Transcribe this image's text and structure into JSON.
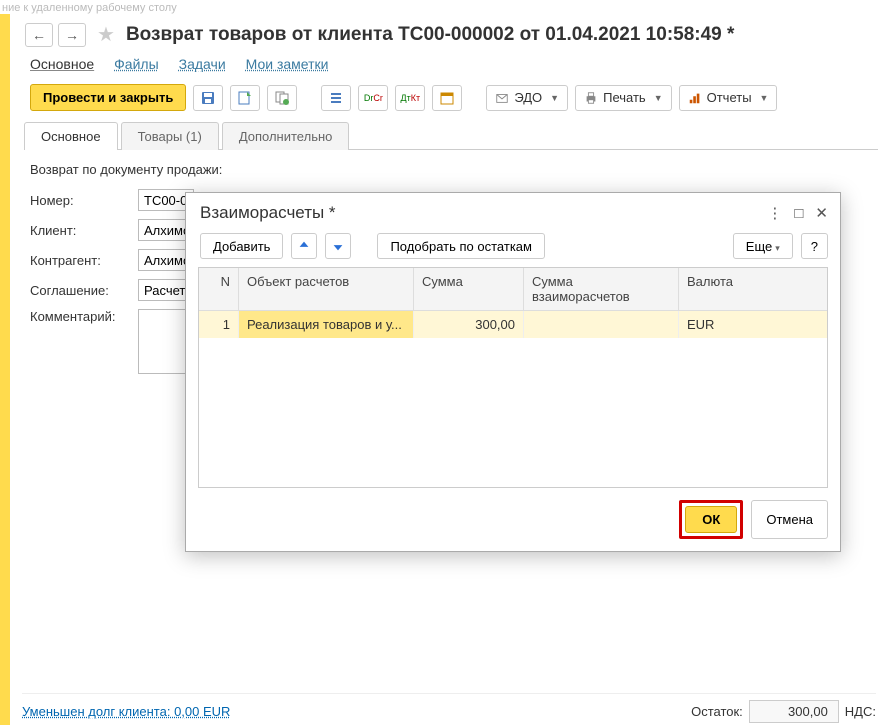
{
  "faded_top": "ние к удаленному рабочему столу",
  "header": {
    "title": "Возврат товаров от клиента ТС00-000002 от 01.04.2021 10:58:49 *"
  },
  "links": {
    "main": "Основное",
    "files": "Файлы",
    "tasks": "Задачи",
    "notes": "Мои заметки"
  },
  "toolbar": {
    "post_close": "Провести и закрыть",
    "edo": "ЭДО",
    "print": "Печать",
    "reports": "Отчеты"
  },
  "tabs": {
    "main": "Основное",
    "goods": "Товары (1)",
    "extra": "Дополнительно"
  },
  "subtext": "Возврат по документу продажи:",
  "form": {
    "number_label": "Номер:",
    "number_value": "ТС00-0",
    "client_label": "Клиент:",
    "client_value": "Алхимо",
    "contragent_label": "Контрагент:",
    "contragent_value": "Алхимо",
    "agreement_label": "Соглашение:",
    "agreement_value": "Расчеть",
    "comment_label": "Комментарий:"
  },
  "dialog": {
    "title": "Взаиморасчеты *",
    "add": "Добавить",
    "pick": "Подобрать по остаткам",
    "more": "Еще",
    "help": "?",
    "columns": {
      "n": "N",
      "object": "Объект расчетов",
      "sum": "Сумма",
      "mutual": "Сумма взаиморасчетов",
      "currency": "Валюта"
    },
    "rows": [
      {
        "n": "1",
        "object": "Реализация товаров и у...",
        "sum": "300,00",
        "mutual": "",
        "currency": "EUR"
      }
    ],
    "ok": "ОК",
    "cancel": "Отмена"
  },
  "footer": {
    "debt_link": "Уменьшен долг клиента: 0,00 EUR",
    "balance_label": "Остаток:",
    "balance_value": "300,00",
    "nds_label": "НДС:"
  }
}
